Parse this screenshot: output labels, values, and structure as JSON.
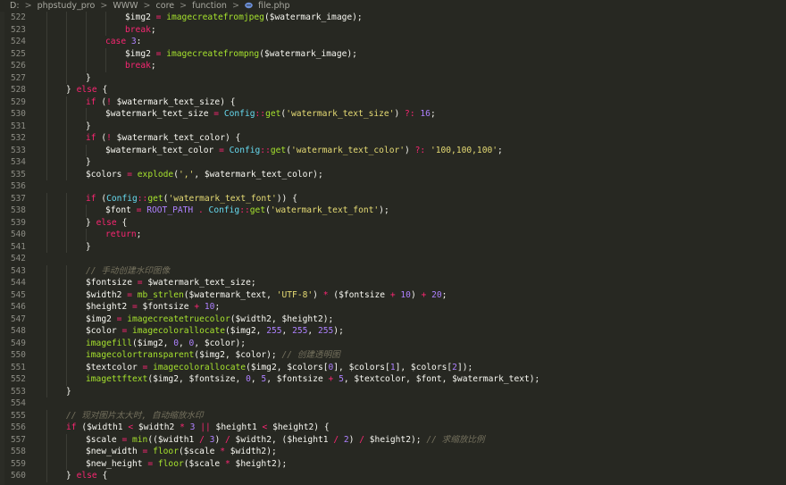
{
  "breadcrumb": {
    "drive": "D:",
    "segments": [
      "phpstudy_pro",
      "WWW",
      "core",
      "function"
    ],
    "file": "file.php",
    "separator": ">"
  },
  "colors": {
    "background": "#272822",
    "line_number": "#8c8c84",
    "keyword": "#f92672",
    "function": "#a6e22e",
    "class": "#66d9ef",
    "number": "#ae81ff",
    "string": "#e6db74",
    "comment": "#75715e",
    "default": "#f8f8f2",
    "php_icon": "#6b8ed6"
  },
  "lines": [
    {
      "n": "522",
      "indent": 4,
      "tokens": [
        [
          "var",
          "$img2 "
        ],
        [
          "op",
          "="
        ],
        [
          "pun",
          " "
        ],
        [
          "fn",
          "imagecreatefromjpeg"
        ],
        [
          "pun",
          "($watermark_image);"
        ]
      ]
    },
    {
      "n": "523",
      "indent": 4,
      "tokens": [
        [
          "kw",
          "break"
        ],
        [
          "pun",
          ";"
        ]
      ]
    },
    {
      "n": "524",
      "indent": 3,
      "tokens": [
        [
          "kw",
          "case "
        ],
        [
          "num",
          "3"
        ],
        [
          "pun",
          ":"
        ]
      ]
    },
    {
      "n": "525",
      "indent": 4,
      "tokens": [
        [
          "var",
          "$img2 "
        ],
        [
          "op",
          "="
        ],
        [
          "pun",
          " "
        ],
        [
          "fn",
          "imagecreatefrompng"
        ],
        [
          "pun",
          "($watermark_image);"
        ]
      ]
    },
    {
      "n": "526",
      "indent": 4,
      "tokens": [
        [
          "kw",
          "break"
        ],
        [
          "pun",
          ";"
        ]
      ]
    },
    {
      "n": "527",
      "indent": 2,
      "tokens": [
        [
          "pun",
          "}"
        ]
      ]
    },
    {
      "n": "528",
      "indent": 1,
      "tokens": [
        [
          "pun",
          "} "
        ],
        [
          "kw",
          "else"
        ],
        [
          "pun",
          " {"
        ]
      ]
    },
    {
      "n": "529",
      "indent": 2,
      "tokens": [
        [
          "kw",
          "if"
        ],
        [
          "pun",
          " ("
        ],
        [
          "op",
          "!"
        ],
        [
          "pun",
          " $watermark_text_size) {"
        ]
      ]
    },
    {
      "n": "530",
      "indent": 3,
      "tokens": [
        [
          "var",
          "$watermark_text_size "
        ],
        [
          "op",
          "="
        ],
        [
          "pun",
          " "
        ],
        [
          "cls",
          "Config"
        ],
        [
          "op",
          "::"
        ],
        [
          "fn",
          "get"
        ],
        [
          "pun",
          "("
        ],
        [
          "str",
          "'watermark_text_size'"
        ],
        [
          "pun",
          ") "
        ],
        [
          "op",
          "?:"
        ],
        [
          "pun",
          " "
        ],
        [
          "num",
          "16"
        ],
        [
          "pun",
          ";"
        ]
      ]
    },
    {
      "n": "531",
      "indent": 2,
      "tokens": [
        [
          "pun",
          "}"
        ]
      ]
    },
    {
      "n": "532",
      "indent": 2,
      "tokens": [
        [
          "kw",
          "if"
        ],
        [
          "pun",
          " ("
        ],
        [
          "op",
          "!"
        ],
        [
          "pun",
          " $watermark_text_color) {"
        ]
      ]
    },
    {
      "n": "533",
      "indent": 3,
      "tokens": [
        [
          "var",
          "$watermark_text_color "
        ],
        [
          "op",
          "="
        ],
        [
          "pun",
          " "
        ],
        [
          "cls",
          "Config"
        ],
        [
          "op",
          "::"
        ],
        [
          "fn",
          "get"
        ],
        [
          "pun",
          "("
        ],
        [
          "str",
          "'watermark_text_color'"
        ],
        [
          "pun",
          ") "
        ],
        [
          "op",
          "?:"
        ],
        [
          "pun",
          " "
        ],
        [
          "str",
          "'100,100,100'"
        ],
        [
          "pun",
          ";"
        ]
      ]
    },
    {
      "n": "534",
      "indent": 2,
      "tokens": [
        [
          "pun",
          "}"
        ]
      ]
    },
    {
      "n": "535",
      "indent": 2,
      "tokens": [
        [
          "var",
          "$colors "
        ],
        [
          "op",
          "="
        ],
        [
          "pun",
          " "
        ],
        [
          "fn",
          "explode"
        ],
        [
          "pun",
          "("
        ],
        [
          "str",
          "','"
        ],
        [
          "pun",
          ", $watermark_text_color);"
        ]
      ]
    },
    {
      "n": "536",
      "indent": 0,
      "tokens": []
    },
    {
      "n": "537",
      "indent": 2,
      "tokens": [
        [
          "kw",
          "if"
        ],
        [
          "pun",
          " ("
        ],
        [
          "cls",
          "Config"
        ],
        [
          "op",
          "::"
        ],
        [
          "fn",
          "get"
        ],
        [
          "pun",
          "("
        ],
        [
          "str",
          "'watermark_text_font'"
        ],
        [
          "pun",
          ")) {"
        ]
      ]
    },
    {
      "n": "538",
      "indent": 3,
      "tokens": [
        [
          "var",
          "$font "
        ],
        [
          "op",
          "="
        ],
        [
          "pun",
          " "
        ],
        [
          "const",
          "ROOT_PATH"
        ],
        [
          "pun",
          " "
        ],
        [
          "op",
          "."
        ],
        [
          "pun",
          " "
        ],
        [
          "cls",
          "Config"
        ],
        [
          "op",
          "::"
        ],
        [
          "fn",
          "get"
        ],
        [
          "pun",
          "("
        ],
        [
          "str",
          "'watermark_text_font'"
        ],
        [
          "pun",
          ");"
        ]
      ]
    },
    {
      "n": "539",
      "indent": 2,
      "tokens": [
        [
          "pun",
          "} "
        ],
        [
          "kw",
          "else"
        ],
        [
          "pun",
          " {"
        ]
      ]
    },
    {
      "n": "540",
      "indent": 3,
      "tokens": [
        [
          "kw",
          "return"
        ],
        [
          "pun",
          ";"
        ]
      ]
    },
    {
      "n": "541",
      "indent": 2,
      "tokens": [
        [
          "pun",
          "}"
        ]
      ]
    },
    {
      "n": "542",
      "indent": 0,
      "tokens": []
    },
    {
      "n": "543",
      "indent": 2,
      "tokens": [
        [
          "cm",
          "// 手动创建水印图像"
        ]
      ]
    },
    {
      "n": "544",
      "indent": 2,
      "tokens": [
        [
          "var",
          "$fontsize "
        ],
        [
          "op",
          "="
        ],
        [
          "pun",
          " $watermark_text_size;"
        ]
      ]
    },
    {
      "n": "545",
      "indent": 2,
      "tokens": [
        [
          "var",
          "$width2 "
        ],
        [
          "op",
          "="
        ],
        [
          "pun",
          " "
        ],
        [
          "fn",
          "mb_strlen"
        ],
        [
          "pun",
          "($watermark_text, "
        ],
        [
          "str",
          "'UTF-8'"
        ],
        [
          "pun",
          ") "
        ],
        [
          "op",
          "*"
        ],
        [
          "pun",
          " ($fontsize "
        ],
        [
          "op",
          "+"
        ],
        [
          "pun",
          " "
        ],
        [
          "num",
          "10"
        ],
        [
          "pun",
          ") "
        ],
        [
          "op",
          "+"
        ],
        [
          "pun",
          " "
        ],
        [
          "num",
          "20"
        ],
        [
          "pun",
          ";"
        ]
      ]
    },
    {
      "n": "546",
      "indent": 2,
      "tokens": [
        [
          "var",
          "$height2 "
        ],
        [
          "op",
          "="
        ],
        [
          "pun",
          " $fontsize "
        ],
        [
          "op",
          "+"
        ],
        [
          "pun",
          " "
        ],
        [
          "num",
          "10"
        ],
        [
          "pun",
          ";"
        ]
      ]
    },
    {
      "n": "547",
      "indent": 2,
      "tokens": [
        [
          "var",
          "$img2 "
        ],
        [
          "op",
          "="
        ],
        [
          "pun",
          " "
        ],
        [
          "fn",
          "imagecreatetruecolor"
        ],
        [
          "pun",
          "($width2, $height2);"
        ]
      ]
    },
    {
      "n": "548",
      "indent": 2,
      "tokens": [
        [
          "var",
          "$color "
        ],
        [
          "op",
          "="
        ],
        [
          "pun",
          " "
        ],
        [
          "fn",
          "imagecolorallocate"
        ],
        [
          "pun",
          "($img2, "
        ],
        [
          "num",
          "255"
        ],
        [
          "pun",
          ", "
        ],
        [
          "num",
          "255"
        ],
        [
          "pun",
          ", "
        ],
        [
          "num",
          "255"
        ],
        [
          "pun",
          ");"
        ]
      ]
    },
    {
      "n": "549",
      "indent": 2,
      "tokens": [
        [
          "fn",
          "imagefill"
        ],
        [
          "pun",
          "($img2, "
        ],
        [
          "num",
          "0"
        ],
        [
          "pun",
          ", "
        ],
        [
          "num",
          "0"
        ],
        [
          "pun",
          ", $color);"
        ]
      ]
    },
    {
      "n": "550",
      "indent": 2,
      "tokens": [
        [
          "fn",
          "imagecolortransparent"
        ],
        [
          "pun",
          "($img2, $color); "
        ],
        [
          "cm",
          "// 创建透明图"
        ]
      ]
    },
    {
      "n": "551",
      "indent": 2,
      "tokens": [
        [
          "var",
          "$textcolor "
        ],
        [
          "op",
          "="
        ],
        [
          "pun",
          " "
        ],
        [
          "fn",
          "imagecolorallocate"
        ],
        [
          "pun",
          "($img2, $colors["
        ],
        [
          "num",
          "0"
        ],
        [
          "pun",
          "], $colors["
        ],
        [
          "num",
          "1"
        ],
        [
          "pun",
          "], $colors["
        ],
        [
          "num",
          "2"
        ],
        [
          "pun",
          "]);"
        ]
      ]
    },
    {
      "n": "552",
      "indent": 2,
      "tokens": [
        [
          "fn",
          "imagettftext"
        ],
        [
          "pun",
          "($img2, $fontsize, "
        ],
        [
          "num",
          "0"
        ],
        [
          "pun",
          ", "
        ],
        [
          "num",
          "5"
        ],
        [
          "pun",
          ", $fontsize "
        ],
        [
          "op",
          "+"
        ],
        [
          "pun",
          " "
        ],
        [
          "num",
          "5"
        ],
        [
          "pun",
          ", $textcolor, $font, $watermark_text);"
        ]
      ]
    },
    {
      "n": "553",
      "indent": 1,
      "tokens": [
        [
          "pun",
          "}"
        ]
      ]
    },
    {
      "n": "554",
      "indent": 0,
      "tokens": []
    },
    {
      "n": "555",
      "indent": 1,
      "tokens": [
        [
          "cm",
          "// 现对图片太大时, 自动缩放水印"
        ]
      ]
    },
    {
      "n": "556",
      "indent": 1,
      "tokens": [
        [
          "kw",
          "if"
        ],
        [
          "pun",
          " ($width1 "
        ],
        [
          "op",
          "<"
        ],
        [
          "pun",
          " $width2 "
        ],
        [
          "op",
          "*"
        ],
        [
          "pun",
          " "
        ],
        [
          "num",
          "3"
        ],
        [
          "pun",
          " "
        ],
        [
          "op",
          "||"
        ],
        [
          "pun",
          " $height1 "
        ],
        [
          "op",
          "<"
        ],
        [
          "pun",
          " $height2) {"
        ]
      ]
    },
    {
      "n": "557",
      "indent": 2,
      "tokens": [
        [
          "var",
          "$scale "
        ],
        [
          "op",
          "="
        ],
        [
          "pun",
          " "
        ],
        [
          "fn",
          "min"
        ],
        [
          "pun",
          "(($width1 "
        ],
        [
          "op",
          "/"
        ],
        [
          "pun",
          " "
        ],
        [
          "num",
          "3"
        ],
        [
          "pun",
          ") "
        ],
        [
          "op",
          "/"
        ],
        [
          "pun",
          " $width2, ($height1 "
        ],
        [
          "op",
          "/"
        ],
        [
          "pun",
          " "
        ],
        [
          "num",
          "2"
        ],
        [
          "pun",
          ") "
        ],
        [
          "op",
          "/"
        ],
        [
          "pun",
          " $height2); "
        ],
        [
          "cm",
          "// 求缩放比例"
        ]
      ]
    },
    {
      "n": "558",
      "indent": 2,
      "tokens": [
        [
          "var",
          "$new_width "
        ],
        [
          "op",
          "="
        ],
        [
          "pun",
          " "
        ],
        [
          "fn",
          "floor"
        ],
        [
          "pun",
          "($scale "
        ],
        [
          "op",
          "*"
        ],
        [
          "pun",
          " $width2);"
        ]
      ]
    },
    {
      "n": "559",
      "indent": 2,
      "tokens": [
        [
          "var",
          "$new_height "
        ],
        [
          "op",
          "="
        ],
        [
          "pun",
          " "
        ],
        [
          "fn",
          "floor"
        ],
        [
          "pun",
          "($scale "
        ],
        [
          "op",
          "*"
        ],
        [
          "pun",
          " $height2);"
        ]
      ]
    },
    {
      "n": "560",
      "indent": 1,
      "tokens": [
        [
          "pun",
          "} "
        ],
        [
          "kw",
          "else"
        ],
        [
          "pun",
          " {"
        ]
      ]
    }
  ]
}
